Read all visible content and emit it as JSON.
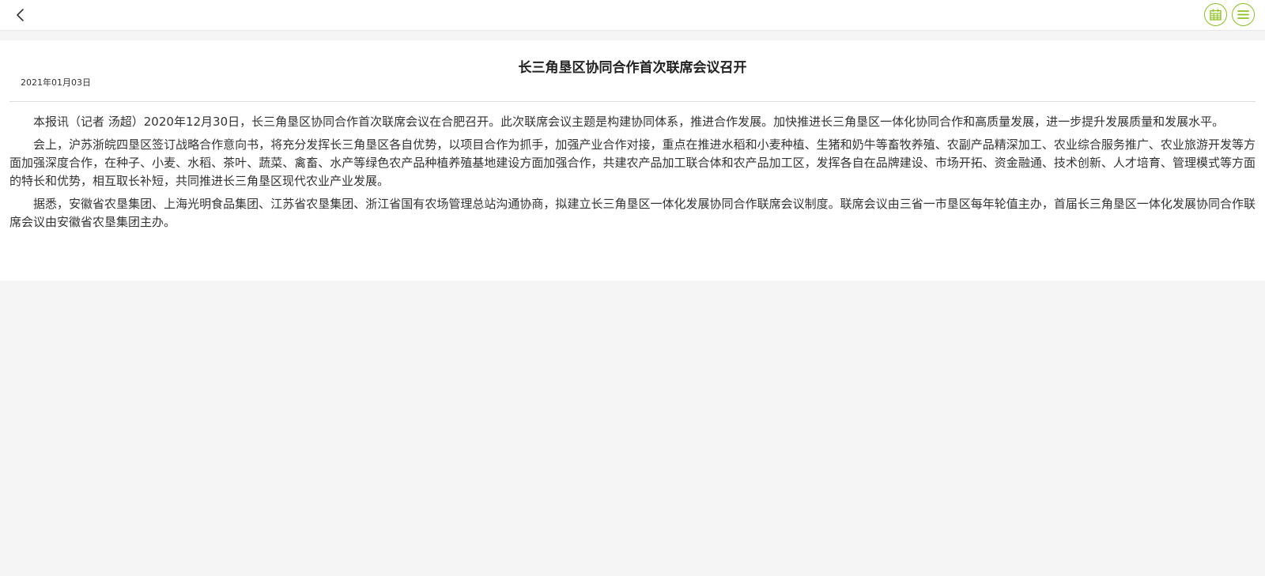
{
  "header": {
    "back_icon": "chevron-left-icon",
    "calendar_icon": "calendar-icon",
    "menu_icon": "hamburger-menu-icon",
    "accent_color": "#8dc21f"
  },
  "article": {
    "title": "长三角垦区协同合作首次联席会议召开",
    "date": "2021年01月03日",
    "paragraphs": [
      "本报讯（记者 汤超）2020年12月30日，长三角垦区协同合作首次联席会议在合肥召开。此次联席会议主题是构建协同体系，推进合作发展。加快推进长三角垦区一体化协同合作和高质量发展，进一步提升发展质量和发展水平。",
      "会上，沪苏浙皖四垦区签订战略合作意向书，将充分发挥长三角垦区各自优势，以项目合作为抓手，加强产业合作对接，重点在推进水稻和小麦种植、生猪和奶牛等畜牧养殖、农副产品精深加工、农业综合服务推广、农业旅游开发等方面加强深度合作，在种子、小麦、水稻、茶叶、蔬菜、禽畜、水产等绿色农产品种植养殖基地建设方面加强合作，共建农产品加工联合体和农产品加工区，发挥各自在品牌建设、市场开拓、资金融通、技术创新、人才培育、管理模式等方面的特长和优势，相互取长补短，共同推进长三角垦区现代农业产业发展。",
      "据悉，安徽省农垦集团、上海光明食品集团、江苏省农垦集团、浙江省国有农场管理总站沟通协商，拟建立长三角垦区一体化发展协同合作联席会议制度。联席会议由三省一市垦区每年轮值主办，首届长三角垦区一体化发展协同合作联席会议由安徽省农垦集团主办。"
    ]
  }
}
